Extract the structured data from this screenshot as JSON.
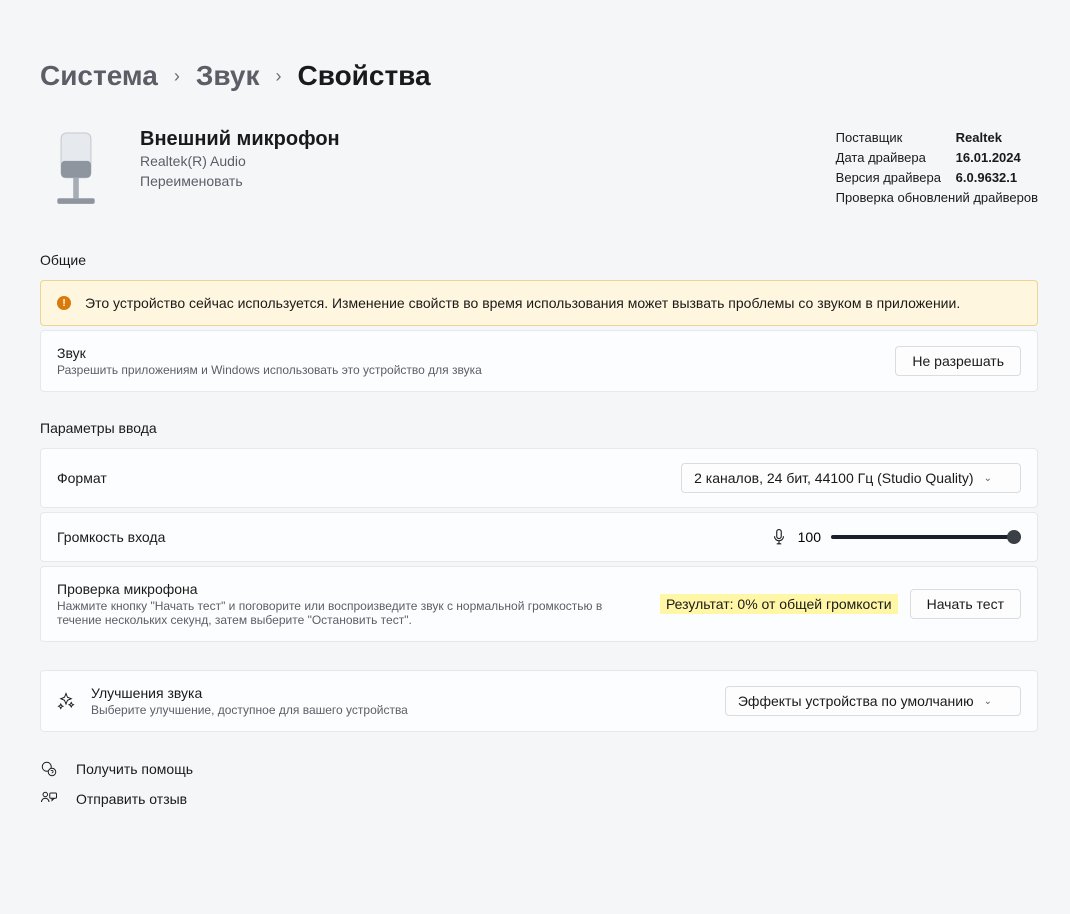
{
  "breadcrumb": {
    "system": "Система",
    "sound": "Звук",
    "properties": "Свойства"
  },
  "device": {
    "title": "Внешний микрофон",
    "subtitle": "Realtek(R) Audio",
    "rename": "Переименовать"
  },
  "driver": {
    "vendor_key": "Поставщик",
    "vendor_val": "Realtek",
    "date_key": "Дата драйвера",
    "date_val": "16.01.2024",
    "version_key": "Версия драйвера",
    "version_val": "6.0.9632.1",
    "check_updates": "Проверка обновлений драйверов"
  },
  "sections": {
    "general": "Общие",
    "input_params": "Параметры ввода"
  },
  "warning": {
    "text": "Это устройство сейчас используется. Изменение свойств во время использования может вызвать проблемы со звуком в приложении."
  },
  "allow": {
    "title": "Звук",
    "desc": "Разрешить приложениям и Windows использовать это устройство для звука",
    "button": "Не разрешать"
  },
  "format": {
    "label": "Формат",
    "value": "2 каналов, 24 бит, 44100 Гц (Studio Quality)"
  },
  "volume": {
    "label": "Громкость входа",
    "value": "100"
  },
  "test": {
    "title": "Проверка микрофона",
    "desc": "Нажмите кнопку \"Начать тест\" и поговорите или воспроизведите звук с нормальной громкостью в течение нескольких секунд, затем выберите \"Остановить тест\".",
    "result": "Результат: 0% от общей громкости",
    "button": "Начать тест"
  },
  "enhance": {
    "title": "Улучшения звука",
    "desc": "Выберите улучшение, доступное для вашего устройства",
    "value": "Эффекты устройства по умолчанию"
  },
  "footer": {
    "help": "Получить помощь",
    "feedback": "Отправить отзыв"
  }
}
